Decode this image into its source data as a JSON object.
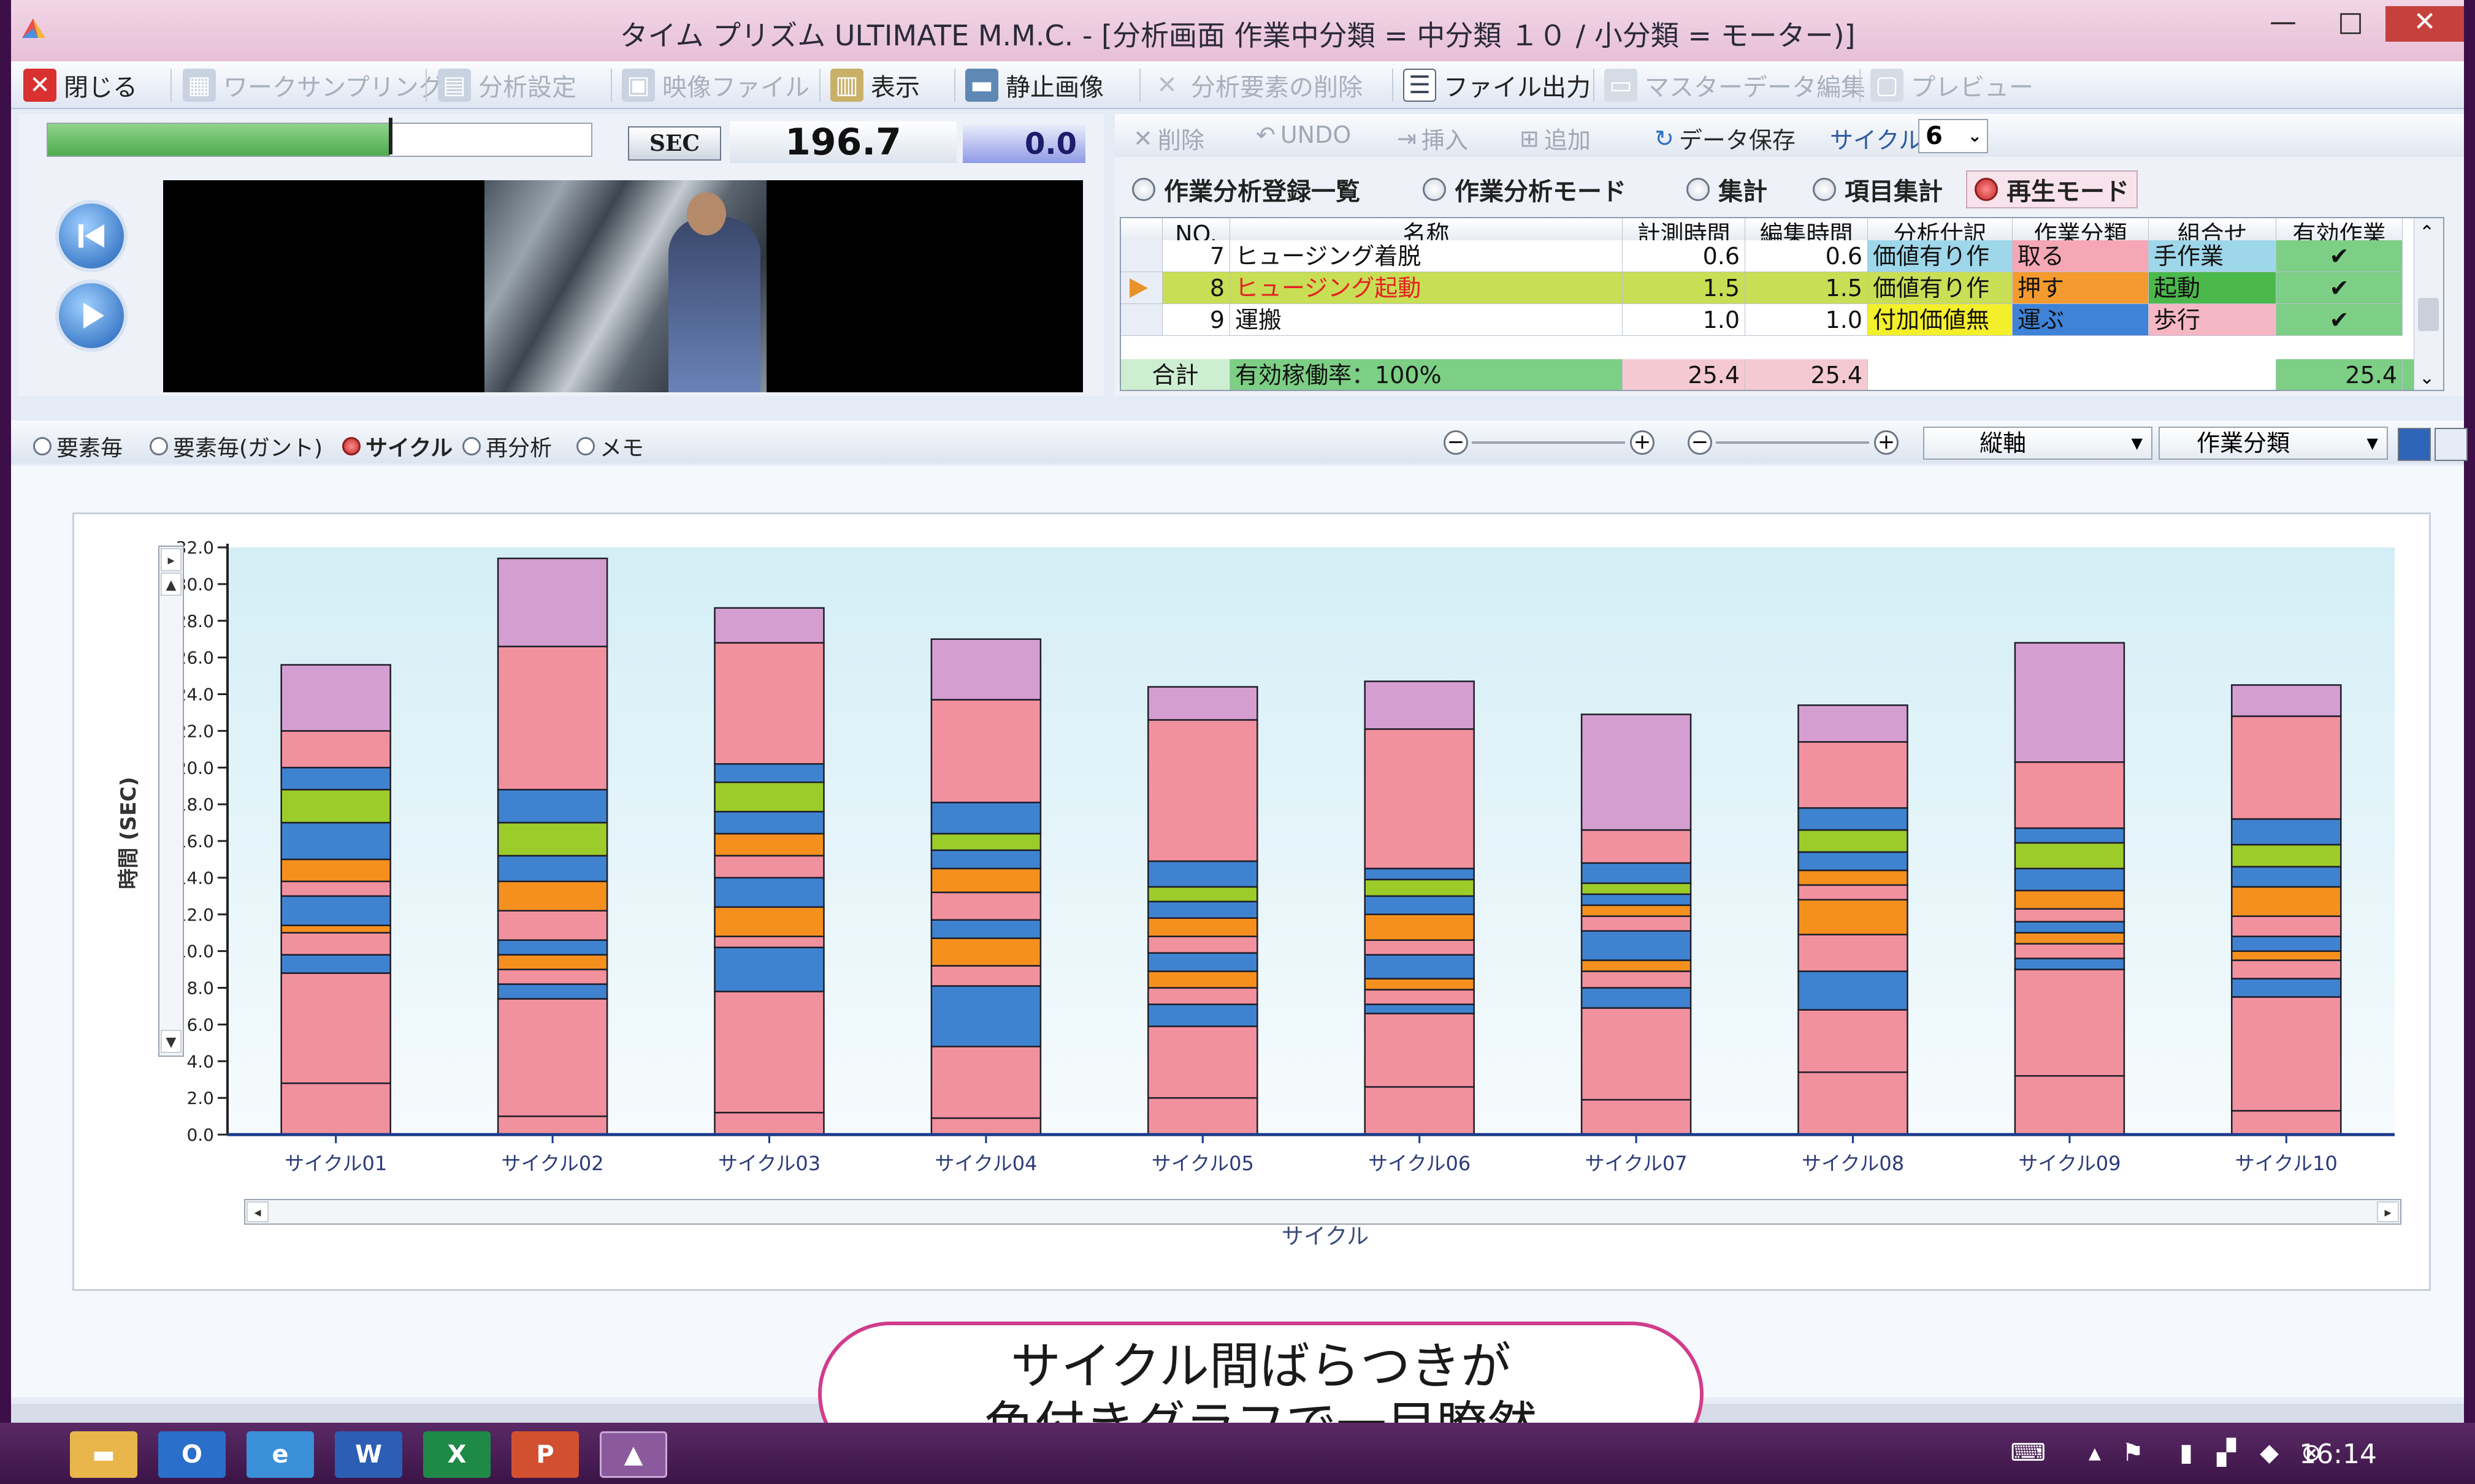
{
  "window": {
    "title": "タイム プリズム ULTIMATE M.M.C. - [分析画面 作業中分類 = 中分類 １０ / 小分類 = モーター)]",
    "minimize": "—",
    "maximize": "□",
    "close": "✕"
  },
  "menubar": {
    "items": [
      {
        "label": "閉じる",
        "enabled": true,
        "icon": "close-x-icon"
      },
      {
        "label": "ワークサンプリング",
        "enabled": false,
        "icon": "sampling-icon"
      },
      {
        "label": "分析設定",
        "enabled": false,
        "icon": "settings-icon"
      },
      {
        "label": "映像ファイル",
        "enabled": false,
        "icon": "video-file-icon"
      },
      {
        "label": "表示",
        "enabled": true,
        "icon": "display-icon"
      },
      {
        "label": "静止画像",
        "enabled": true,
        "icon": "still-image-icon"
      },
      {
        "label": "分析要素の削除",
        "enabled": false,
        "icon": "delete-element-icon"
      },
      {
        "label": "ファイル出力",
        "enabled": true,
        "icon": "file-output-icon"
      },
      {
        "label": "マスターデータ編集",
        "enabled": false,
        "icon": "master-edit-icon"
      },
      {
        "label": "プレビュー",
        "enabled": false,
        "icon": "preview-icon"
      }
    ]
  },
  "player": {
    "unit": "SEC",
    "time": "196.7",
    "offset": "0.0",
    "progress": 0.63
  },
  "right_toolbar": {
    "delete": "削除",
    "undo": "UNDO",
    "insert": "挿入",
    "add": "追加",
    "save": "データ保存",
    "cycle_label": "サイクル",
    "cycle_value": "6"
  },
  "modes": [
    {
      "label": "作業分析登録一覧",
      "active": false
    },
    {
      "label": "作業分析モード",
      "active": false
    },
    {
      "label": "集計",
      "active": false
    },
    {
      "label": "項目集計",
      "active": false
    },
    {
      "label": "再生モード",
      "active": true
    }
  ],
  "grid": {
    "headers": [
      "NO.",
      "名称",
      "計測時間",
      "編集時間",
      "分析仕訳",
      "作業分類",
      "組合せ",
      "有効作業"
    ],
    "rows": [
      {
        "no": "7",
        "name": "ヒュージング着脱",
        "measure": "0.6",
        "edit": "0.6",
        "analysis": "価値有り作",
        "work": "取る",
        "combo": "手作業",
        "valid": "✔",
        "bg": "#ffffff",
        "namecolor": "#111111",
        "analysisbg": "#9fd7ea",
        "workbg": "#f5a7b5",
        "combobg": "#9fd7ea"
      },
      {
        "no": "8",
        "name": "ヒュージング起動",
        "measure": "1.5",
        "edit": "1.5",
        "analysis": "価値有り作",
        "work": "押す",
        "combo": "起動",
        "valid": "✔",
        "bg": "#c8de55",
        "namecolor": "#e52222",
        "analysisbg": "#c8de55",
        "workbg": "#f59a2e",
        "combobg": "#4bb84b"
      },
      {
        "no": "9",
        "name": "運搬",
        "measure": "1.0",
        "edit": "1.0",
        "analysis": "付加価値無",
        "work": "運ぶ",
        "combo": "歩行",
        "valid": "✔",
        "bg": "#ffffff",
        "namecolor": "#111111",
        "analysisbg": "#f3ef2b",
        "workbg": "#3f83d8",
        "combobg": "#f5b7c4"
      }
    ],
    "total": {
      "label": "合計",
      "rate": "有効稼働率：100%",
      "measure": "25.4",
      "edit": "25.4",
      "valid": "25.4"
    }
  },
  "lower_tabs": [
    {
      "label": "要素毎",
      "active": false
    },
    {
      "label": "要素毎(ガント)",
      "active": false
    },
    {
      "label": "サイクル",
      "active": true
    },
    {
      "label": "再分析",
      "active": false
    },
    {
      "label": "メモ",
      "active": false
    }
  ],
  "dropdowns": {
    "axis": "縦軸",
    "category": "作業分類"
  },
  "callout": {
    "line1": "サイクル間ばらつきが",
    "line2": "色付きグラフで一目瞭然"
  },
  "taskbar": {
    "clock": "16:14"
  },
  "colors": {
    "pink": "#f2919e",
    "blue": "#3f83d0",
    "orange": "#f5901e",
    "green": "#9ccc2a",
    "purple": "#d59ed0"
  },
  "chart_data": {
    "type": "bar",
    "stacked": true,
    "xlabel": "サイクル",
    "ylabel": "時間 (SEC)",
    "ylim": [
      0,
      32
    ],
    "yticks": [
      "0.0",
      "2.0",
      "4.0",
      "6.0",
      "8.0",
      "10.0",
      "12.0",
      "14.0",
      "16.0",
      "18.0",
      "20.0",
      "22.0",
      "24.0",
      "26.0",
      "28.0",
      "30.0",
      "32.0"
    ],
    "categories": [
      "サイクル01",
      "サイクル02",
      "サイクル03",
      "サイクル04",
      "サイクル05",
      "サイクル06",
      "サイクル07",
      "サイクル08",
      "サイクル09",
      "サイクル10"
    ],
    "stacks": [
      {
        "segments": [
          {
            "v": 2.8,
            "c": "pink"
          },
          {
            "v": 6.0,
            "c": "pink"
          },
          {
            "v": 1.0,
            "c": "blue"
          },
          {
            "v": 1.2,
            "c": "pink"
          },
          {
            "v": 0.4,
            "c": "orange"
          },
          {
            "v": 1.6,
            "c": "blue"
          },
          {
            "v": 0.8,
            "c": "pink"
          },
          {
            "v": 1.2,
            "c": "orange"
          },
          {
            "v": 2.0,
            "c": "blue"
          },
          {
            "v": 1.8,
            "c": "green"
          },
          {
            "v": 1.2,
            "c": "blue"
          },
          {
            "v": 2.0,
            "c": "pink"
          },
          {
            "v": 3.6,
            "c": "purple"
          }
        ]
      },
      {
        "segments": [
          {
            "v": 1.0,
            "c": "pink"
          },
          {
            "v": 6.4,
            "c": "pink"
          },
          {
            "v": 0.8,
            "c": "blue"
          },
          {
            "v": 0.8,
            "c": "pink"
          },
          {
            "v": 0.8,
            "c": "orange"
          },
          {
            "v": 0.8,
            "c": "blue"
          },
          {
            "v": 1.6,
            "c": "pink"
          },
          {
            "v": 1.6,
            "c": "orange"
          },
          {
            "v": 1.4,
            "c": "blue"
          },
          {
            "v": 1.8,
            "c": "green"
          },
          {
            "v": 1.8,
            "c": "blue"
          },
          {
            "v": 7.8,
            "c": "pink"
          },
          {
            "v": 4.8,
            "c": "purple"
          }
        ]
      },
      {
        "segments": [
          {
            "v": 1.2,
            "c": "pink"
          },
          {
            "v": 6.6,
            "c": "pink"
          },
          {
            "v": 2.4,
            "c": "blue"
          },
          {
            "v": 0.6,
            "c": "pink"
          },
          {
            "v": 1.6,
            "c": "orange"
          },
          {
            "v": 1.6,
            "c": "blue"
          },
          {
            "v": 1.2,
            "c": "pink"
          },
          {
            "v": 1.2,
            "c": "orange"
          },
          {
            "v": 1.2,
            "c": "blue"
          },
          {
            "v": 1.6,
            "c": "green"
          },
          {
            "v": 1.0,
            "c": "blue"
          },
          {
            "v": 6.6,
            "c": "pink"
          },
          {
            "v": 1.9,
            "c": "purple"
          }
        ]
      },
      {
        "segments": [
          {
            "v": 0.9,
            "c": "pink"
          },
          {
            "v": 3.9,
            "c": "pink"
          },
          {
            "v": 3.3,
            "c": "blue"
          },
          {
            "v": 1.1,
            "c": "pink"
          },
          {
            "v": 1.5,
            "c": "orange"
          },
          {
            "v": 1.0,
            "c": "blue"
          },
          {
            "v": 1.5,
            "c": "pink"
          },
          {
            "v": 1.3,
            "c": "orange"
          },
          {
            "v": 1.0,
            "c": "blue"
          },
          {
            "v": 0.9,
            "c": "green"
          },
          {
            "v": 1.7,
            "c": "blue"
          },
          {
            "v": 5.6,
            "c": "pink"
          },
          {
            "v": 3.3,
            "c": "purple"
          }
        ]
      },
      {
        "segments": [
          {
            "v": 2.0,
            "c": "pink"
          },
          {
            "v": 3.9,
            "c": "pink"
          },
          {
            "v": 1.2,
            "c": "blue"
          },
          {
            "v": 0.9,
            "c": "pink"
          },
          {
            "v": 0.9,
            "c": "orange"
          },
          {
            "v": 1.0,
            "c": "blue"
          },
          {
            "v": 0.9,
            "c": "pink"
          },
          {
            "v": 1.0,
            "c": "orange"
          },
          {
            "v": 0.9,
            "c": "blue"
          },
          {
            "v": 0.8,
            "c": "green"
          },
          {
            "v": 1.4,
            "c": "blue"
          },
          {
            "v": 7.7,
            "c": "pink"
          },
          {
            "v": 1.8,
            "c": "purple"
          }
        ]
      },
      {
        "segments": [
          {
            "v": 2.6,
            "c": "pink"
          },
          {
            "v": 4.0,
            "c": "pink"
          },
          {
            "v": 0.5,
            "c": "blue"
          },
          {
            "v": 0.8,
            "c": "pink"
          },
          {
            "v": 0.6,
            "c": "orange"
          },
          {
            "v": 1.3,
            "c": "blue"
          },
          {
            "v": 0.8,
            "c": "pink"
          },
          {
            "v": 1.4,
            "c": "orange"
          },
          {
            "v": 1.0,
            "c": "blue"
          },
          {
            "v": 0.9,
            "c": "green"
          },
          {
            "v": 0.6,
            "c": "blue"
          },
          {
            "v": 7.6,
            "c": "pink"
          },
          {
            "v": 2.6,
            "c": "purple"
          }
        ]
      },
      {
        "segments": [
          {
            "v": 1.9,
            "c": "pink"
          },
          {
            "v": 5.0,
            "c": "pink"
          },
          {
            "v": 1.1,
            "c": "blue"
          },
          {
            "v": 0.9,
            "c": "pink"
          },
          {
            "v": 0.6,
            "c": "orange"
          },
          {
            "v": 1.6,
            "c": "blue"
          },
          {
            "v": 0.8,
            "c": "pink"
          },
          {
            "v": 0.6,
            "c": "orange"
          },
          {
            "v": 0.6,
            "c": "blue"
          },
          {
            "v": 0.6,
            "c": "green"
          },
          {
            "v": 1.1,
            "c": "blue"
          },
          {
            "v": 1.8,
            "c": "pink"
          },
          {
            "v": 6.3,
            "c": "purple"
          }
        ]
      },
      {
        "segments": [
          {
            "v": 3.4,
            "c": "pink"
          },
          {
            "v": 3.4,
            "c": "pink"
          },
          {
            "v": 2.1,
            "c": "blue"
          },
          {
            "v": 2.0,
            "c": "pink"
          },
          {
            "v": 1.9,
            "c": "orange"
          },
          {
            "v": 0.8,
            "c": "pink"
          },
          {
            "v": 0.8,
            "c": "orange"
          },
          {
            "v": 1.0,
            "c": "blue"
          },
          {
            "v": 1.2,
            "c": "green"
          },
          {
            "v": 1.2,
            "c": "blue"
          },
          {
            "v": 3.6,
            "c": "pink"
          },
          {
            "v": 2.0,
            "c": "purple"
          }
        ]
      },
      {
        "segments": [
          {
            "v": 3.2,
            "c": "pink"
          },
          {
            "v": 5.8,
            "c": "pink"
          },
          {
            "v": 0.6,
            "c": "blue"
          },
          {
            "v": 0.8,
            "c": "pink"
          },
          {
            "v": 0.6,
            "c": "orange"
          },
          {
            "v": 0.6,
            "c": "blue"
          },
          {
            "v": 0.7,
            "c": "pink"
          },
          {
            "v": 1.0,
            "c": "orange"
          },
          {
            "v": 1.2,
            "c": "blue"
          },
          {
            "v": 1.4,
            "c": "green"
          },
          {
            "v": 0.8,
            "c": "blue"
          },
          {
            "v": 3.6,
            "c": "pink"
          },
          {
            "v": 6.5,
            "c": "purple"
          }
        ]
      },
      {
        "segments": [
          {
            "v": 1.3,
            "c": "pink"
          },
          {
            "v": 6.2,
            "c": "pink"
          },
          {
            "v": 1.0,
            "c": "blue"
          },
          {
            "v": 1.0,
            "c": "pink"
          },
          {
            "v": 0.5,
            "c": "orange"
          },
          {
            "v": 0.8,
            "c": "blue"
          },
          {
            "v": 1.1,
            "c": "pink"
          },
          {
            "v": 1.6,
            "c": "orange"
          },
          {
            "v": 1.1,
            "c": "blue"
          },
          {
            "v": 1.2,
            "c": "green"
          },
          {
            "v": 1.4,
            "c": "blue"
          },
          {
            "v": 5.6,
            "c": "pink"
          },
          {
            "v": 1.7,
            "c": "purple"
          }
        ]
      }
    ]
  }
}
